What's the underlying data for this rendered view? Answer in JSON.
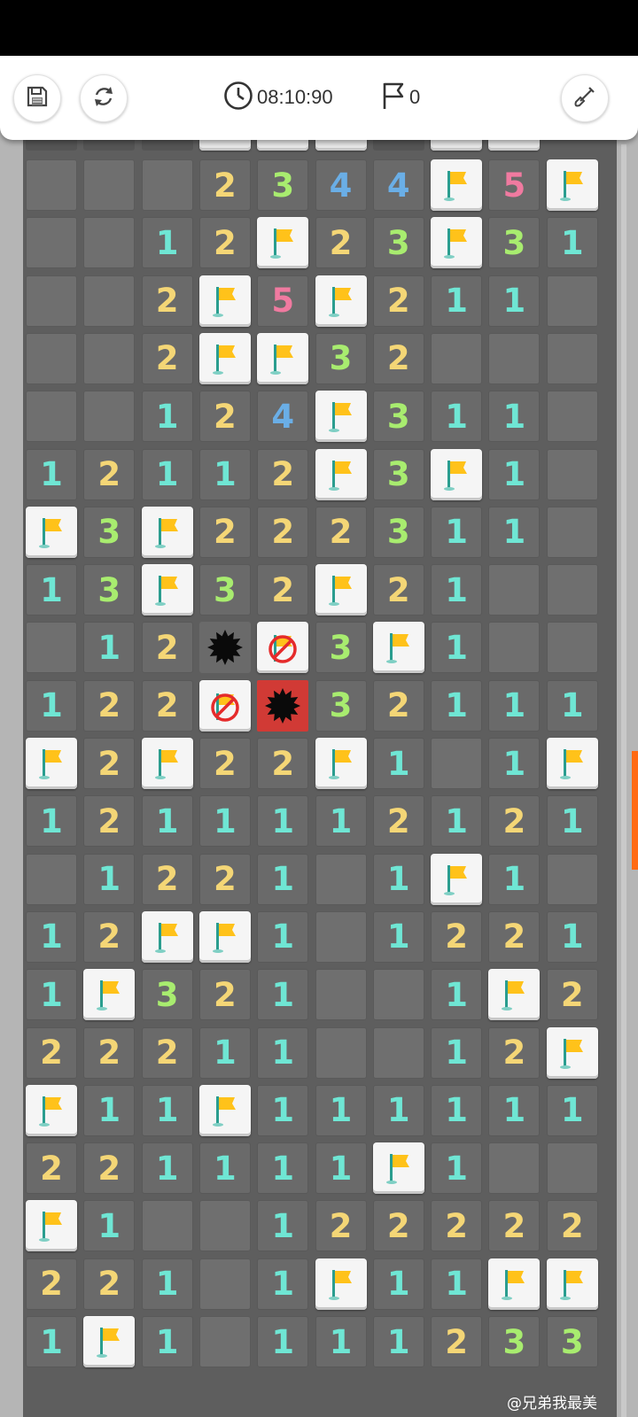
{
  "app": {
    "timer": "08:10:90",
    "flag_count": "0",
    "watermark": "@兄弟我最美"
  },
  "icons": {
    "save": "save-icon",
    "restart": "restart-icon",
    "timer": "clock-icon",
    "flags": "flag-outline-icon",
    "tools": "shovel-icon",
    "flag": "flag-icon",
    "mine": "mine-icon",
    "wrong_flag": "wrong-flag-icon"
  },
  "colors": {
    "1": "#6fe6d4",
    "2": "#f4d676",
    "3": "#a8ec6f",
    "4": "#6aaee6",
    "5": "#f07aa0",
    "flag": "#ffc21a",
    "pole": "#2a9d8f",
    "exploded_bg": "#d13a35"
  },
  "board": {
    "columns": 10,
    "legend": "F = flagged, M = mine, X = exploded mine, W = wrong flag, . = revealed empty, digit = adjacent mine count",
    "partial_top_row": "...FFF.FF",
    "rows": [
      "...2344F5F",
      "..12F23F31",
      "..2F5F211.",
      "..2FF32...",
      "..124F311.",
      "12112F3F1.",
      "F3F222311.",
      "13F32F21..",
      ".12MW3F1..",
      "122WX32111",
      "F2F22F1.1F",
      "1211112121",
      ".1221.1F1.",
      "12FF1.1221",
      "1F321..1F2",
      "22211..12F",
      "F11F111111",
      "221111F1..",
      "F1..122222",
      "221.1F11FF",
      "1F1.111233"
    ]
  }
}
